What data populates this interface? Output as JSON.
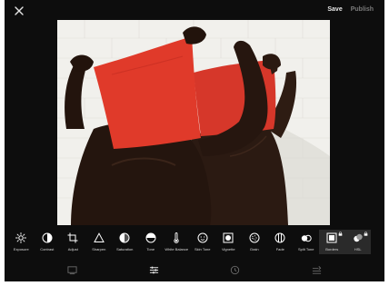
{
  "header": {
    "save_label": "Save",
    "publish_label": "Publish"
  },
  "photo": {
    "alt_icon": "photo-two-people-red-cloth"
  },
  "tools": [
    {
      "label": "Exposure",
      "icon": "sun-icon"
    },
    {
      "label": "Contrast",
      "icon": "contrast-icon"
    },
    {
      "label": "Adjust",
      "icon": "crop-icon"
    },
    {
      "label": "Sharpen",
      "icon": "triangle-icon"
    },
    {
      "label": "Saturation",
      "icon": "saturation-icon"
    },
    {
      "label": "Tone",
      "icon": "tone-icon"
    },
    {
      "label": "White Balance",
      "icon": "thermometer-icon"
    },
    {
      "label": "Skin Tone",
      "icon": "face-icon"
    },
    {
      "label": "Vignette",
      "icon": "vignette-icon"
    },
    {
      "label": "Grain",
      "icon": "grain-icon"
    },
    {
      "label": "Fade",
      "icon": "fade-icon"
    },
    {
      "label": "Split Tone",
      "icon": "split-tone-icon"
    },
    {
      "label": "Borders",
      "icon": "borders-icon",
      "locked": true,
      "selected": true
    },
    {
      "label": "HSL",
      "icon": "hsl-icon",
      "locked": true
    }
  ],
  "bottom_nav": [
    {
      "icon": "presets-icon"
    },
    {
      "icon": "tools-sliders-icon"
    },
    {
      "icon": "history-icon"
    },
    {
      "icon": "recipes-icon"
    }
  ],
  "colors": {
    "background": "#0d0d0d",
    "label": "#d8d8d8",
    "cloth_red": "#e03a2a",
    "wall": "#f2f2f0"
  }
}
